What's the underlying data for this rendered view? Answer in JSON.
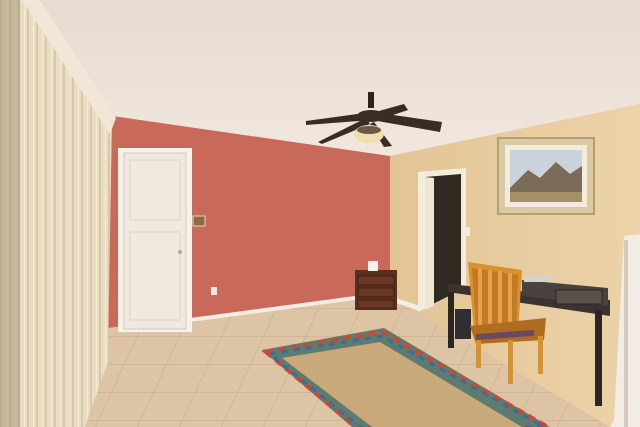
{
  "scene": {
    "colors": {
      "ceiling": "#ece1d6",
      "accent_wall": "#c9695a",
      "right_wall": "#e7cc9c",
      "floor_tile": "#dcc4a4",
      "door": "#efe9df",
      "blinds": "#e9ddc4",
      "rug_center": "#c9a979",
      "chair": "#d9902f",
      "desk": "#3a3330",
      "nightstand": "#5a2f1f"
    },
    "icons": {
      "ceiling_fan": "ceiling-fan-icon",
      "artwork": "framed-landscape-picture"
    }
  }
}
